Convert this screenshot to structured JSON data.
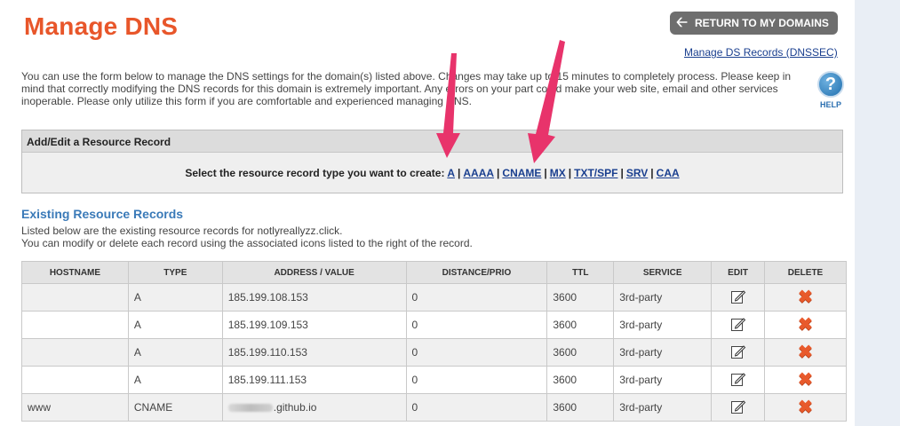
{
  "header": {
    "title": "Manage DNS",
    "return_button": "RETURN TO MY DOMAINS",
    "return_icon": "arrow-left-icon",
    "ds_link": "Manage DS Records (DNSSEC)"
  },
  "intro": "You can use the form below to manage the DNS settings for the domain(s) listed above. Changes may take up to 15 minutes to completely process. Please keep in mind that correctly modifying the DNS records for this domain is extremely important. Any errors on your part could make your web site, email and other services inoperable. Please only utilize this form if you are comfortable and experienced managing DNS.",
  "help": {
    "symbol": "?",
    "label": "HELP"
  },
  "add_record": {
    "header": "Add/Edit a Resource Record",
    "prompt": "Select the resource record type you want to create:",
    "types": [
      "A",
      "AAAA",
      "CNAME",
      "MX",
      "TXT/SPF",
      "SRV",
      "CAA"
    ]
  },
  "existing": {
    "title": "Existing Resource Records",
    "line1": "Listed below are the existing resource records for notlyreallyzz.click.",
    "line2": "You can modify or delete each record using the associated icons listed to the right of the record."
  },
  "table": {
    "columns": [
      "HOSTNAME",
      "TYPE",
      "ADDRESS / VALUE",
      "DISTANCE/PRIO",
      "TTL",
      "SERVICE",
      "EDIT",
      "DELETE"
    ],
    "rows": [
      {
        "hostname": "",
        "type": "A",
        "value": "185.199.108.153",
        "prio": "0",
        "ttl": "3600",
        "service": "3rd-party"
      },
      {
        "hostname": "",
        "type": "A",
        "value": "185.199.109.153",
        "prio": "0",
        "ttl": "3600",
        "service": "3rd-party"
      },
      {
        "hostname": "",
        "type": "A",
        "value": "185.199.110.153",
        "prio": "0",
        "ttl": "3600",
        "service": "3rd-party"
      },
      {
        "hostname": "",
        "type": "A",
        "value": "185.199.111.153",
        "prio": "0",
        "ttl": "3600",
        "service": "3rd-party"
      },
      {
        "hostname": "www",
        "type": "CNAME",
        "value": ".github.io",
        "prio": "0",
        "ttl": "3600",
        "service": "3rd-party"
      }
    ],
    "edit_icon": "edit-pencil-icon",
    "delete_icon": "delete-x-icon"
  },
  "colors": {
    "title": "#e8562a",
    "link": "#1a3f8f",
    "section_title": "#3a7ab8",
    "annotation_arrow": "#e8336b",
    "delete": "#e85a2c"
  }
}
